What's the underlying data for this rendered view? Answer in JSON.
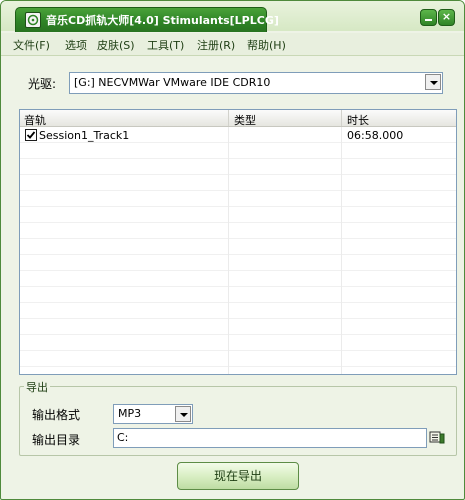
{
  "window": {
    "title": "音乐CD抓轨大师[4.0] Stimulants[LPLCG]",
    "accent_color": "#2f8426",
    "controls": [
      "minimize-icon",
      "close-icon"
    ]
  },
  "menu": {
    "items": [
      {
        "label": "文件(F)"
      },
      {
        "label": "选项"
      },
      {
        "label": "皮肤(S)"
      },
      {
        "label": "工具(T)"
      },
      {
        "label": "注册(R)"
      },
      {
        "label": "帮助(H)"
      }
    ]
  },
  "drive": {
    "label": "光驱:",
    "selected": "[G:] NECVMWar VMware IDE CDR10"
  },
  "tracks": {
    "columns": [
      "音轨",
      "类型",
      "时长"
    ],
    "rows": [
      {
        "checked": true,
        "name": "Session1_Track1",
        "type": "",
        "duration": "06:58.000"
      }
    ]
  },
  "export": {
    "group_label": "导出",
    "format_label": "输出格式",
    "format_value": "MP3",
    "dir_label": "输出目录",
    "dir_value": "C:",
    "browse_icon": "folder-browse-icon",
    "button_label": "现在导出"
  }
}
